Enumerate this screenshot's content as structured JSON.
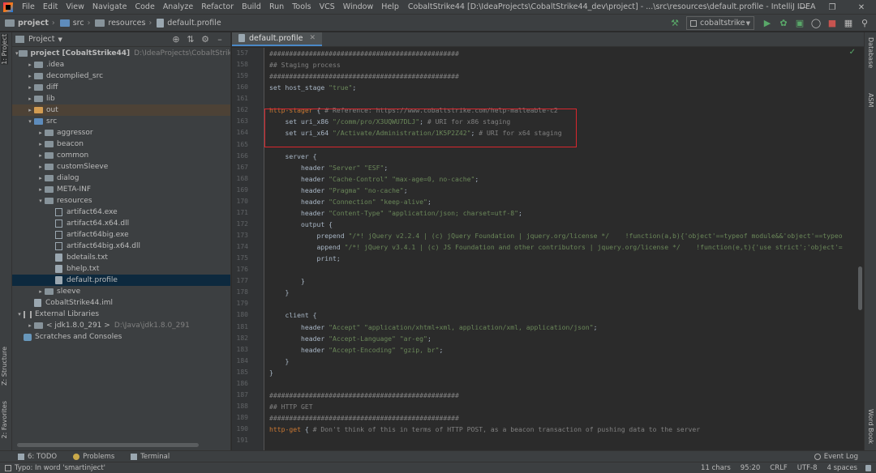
{
  "window": {
    "title": "CobaltStrike44 [D:\\IdeaProjects\\CobaltStrike44_dev\\project] - ...\\src\\resources\\default.profile - IntelliJ IDEA"
  },
  "menu": [
    {
      "label": "File",
      "u": "F",
      "rest": "ile"
    },
    {
      "label": "Edit",
      "u": "E",
      "rest": "dit"
    },
    {
      "label": "View",
      "u": "V",
      "rest": "iew"
    },
    {
      "label": "Navigate",
      "u": "N",
      "rest": "avigate"
    },
    {
      "label": "Code",
      "u": "C",
      "rest": "ode"
    },
    {
      "label": "Analyze",
      "u": "",
      "rest": "Analyze"
    },
    {
      "label": "Refactor",
      "u": "R",
      "rest": "efactor"
    },
    {
      "label": "Build",
      "u": "B",
      "rest": "uild"
    },
    {
      "label": "Run",
      "u": "",
      "rest": "Run"
    },
    {
      "label": "Tools",
      "u": "T",
      "rest": "ools"
    },
    {
      "label": "VCS",
      "u": "",
      "rest": "VCS"
    },
    {
      "label": "Window",
      "u": "W",
      "rest": "indow"
    },
    {
      "label": "Help",
      "u": "H",
      "rest": "elp"
    }
  ],
  "breadcrumbs": [
    "project",
    "src",
    "resources",
    "default.profile"
  ],
  "run_config": "cobaltstrike",
  "left_tools": {
    "project": "1: Project",
    "structure": "Z: Structure",
    "favorites": "2: Favorites"
  },
  "right_tools": {
    "database": "Database",
    "asm": "ASM",
    "word_book": "Word Book"
  },
  "project_panel": {
    "title": "Project"
  },
  "tree": [
    {
      "name": "project [CobaltStrike44]",
      "hint": "D:\\IdeaProjects\\CobaltStrike44_d",
      "depth": 0,
      "arrow": "▾",
      "icon": "folder",
      "bold": true
    },
    {
      "name": ".idea",
      "depth": 1,
      "arrow": "▸",
      "icon": "folder"
    },
    {
      "name": "decomplied_src",
      "depth": 1,
      "arrow": "▸",
      "icon": "folder"
    },
    {
      "name": "diff",
      "depth": 1,
      "arrow": "▸",
      "icon": "folder"
    },
    {
      "name": "lib",
      "depth": 1,
      "arrow": "▸",
      "icon": "folder"
    },
    {
      "name": "out",
      "depth": 1,
      "arrow": "▸",
      "icon": "folder-orange",
      "row": "out"
    },
    {
      "name": "src",
      "depth": 1,
      "arrow": "▾",
      "icon": "folder-blue"
    },
    {
      "name": "aggressor",
      "depth": 2,
      "arrow": "▸",
      "icon": "folder"
    },
    {
      "name": "beacon",
      "depth": 2,
      "arrow": "▸",
      "icon": "folder"
    },
    {
      "name": "common",
      "depth": 2,
      "arrow": "▸",
      "icon": "folder"
    },
    {
      "name": "customSleeve",
      "depth": 2,
      "arrow": "▸",
      "icon": "folder"
    },
    {
      "name": "dialog",
      "depth": 2,
      "arrow": "▸",
      "icon": "folder"
    },
    {
      "name": "META-INF",
      "depth": 2,
      "arrow": "▸",
      "icon": "folder"
    },
    {
      "name": "resources",
      "depth": 2,
      "arrow": "▾",
      "icon": "folder"
    },
    {
      "name": "artifact64.exe",
      "depth": 3,
      "arrow": "",
      "icon": "bin"
    },
    {
      "name": "artifact64.x64.dll",
      "depth": 3,
      "arrow": "",
      "icon": "bin"
    },
    {
      "name": "artifact64big.exe",
      "depth": 3,
      "arrow": "",
      "icon": "bin"
    },
    {
      "name": "artifact64big.x64.dll",
      "depth": 3,
      "arrow": "",
      "icon": "bin"
    },
    {
      "name": "bdetails.txt",
      "depth": 3,
      "arrow": "",
      "icon": "file"
    },
    {
      "name": "bhelp.txt",
      "depth": 3,
      "arrow": "",
      "icon": "file"
    },
    {
      "name": "default.profile",
      "depth": 3,
      "arrow": "",
      "icon": "file",
      "row": "sel"
    },
    {
      "name": "sleeve",
      "depth": 2,
      "arrow": "▸",
      "icon": "folder"
    },
    {
      "name": "CobaltStrike44.iml",
      "depth": 1,
      "arrow": "",
      "icon": "file"
    },
    {
      "name": "External Libraries",
      "depth": 0,
      "arrow": "▾",
      "icon": "lib"
    },
    {
      "name": "< jdk1.8.0_291 >",
      "hint": "D:\\Java\\jdk1.8.0_291",
      "depth": 1,
      "arrow": "▸",
      "icon": "folder"
    },
    {
      "name": "Scratches and Consoles",
      "depth": 0,
      "arrow": "",
      "icon": "scratch"
    }
  ],
  "editor": {
    "tab": "default.profile",
    "lines": [
      {
        "n": "157",
        "t": [
          [
            "cmt",
            "################################################"
          ]
        ]
      },
      {
        "n": "158",
        "t": [
          [
            "cmt",
            "## Staging process"
          ]
        ]
      },
      {
        "n": "159",
        "t": [
          [
            "cmt",
            "################################################"
          ]
        ]
      },
      {
        "n": "160",
        "t": [
          [
            "",
            "set host_stage "
          ],
          [
            "str",
            "\"true\""
          ],
          [
            "",
            ";"
          ]
        ]
      },
      {
        "n": "161",
        "t": []
      },
      {
        "n": "162",
        "t": [
          [
            "kw",
            "http-stager"
          ],
          [
            "",
            " { "
          ],
          [
            "cmt",
            "# Reference: https://www.cobaltstrike.com/help-malleable-c2"
          ]
        ]
      },
      {
        "n": "163",
        "t": [
          [
            "",
            "    set uri_x86 "
          ],
          [
            "str",
            "\"/comm/pro/X3UQWU7DLJ\""
          ],
          [
            "",
            "; "
          ],
          [
            "cmt",
            "# URI for x86 staging"
          ]
        ]
      },
      {
        "n": "164",
        "t": [
          [
            "",
            "    set uri_x64 "
          ],
          [
            "str",
            "\"/Activate/Administration/1K5P2Z42\""
          ],
          [
            "",
            "; "
          ],
          [
            "cmt",
            "# URI for x64 staging"
          ]
        ]
      },
      {
        "n": "165",
        "t": []
      },
      {
        "n": "166",
        "t": [
          [
            "",
            "    server {"
          ]
        ]
      },
      {
        "n": "167",
        "t": [
          [
            "",
            "        header "
          ],
          [
            "str",
            "\"Server\""
          ],
          [
            "",
            " "
          ],
          [
            "str",
            "\"ESF\""
          ],
          [
            "",
            ";"
          ]
        ]
      },
      {
        "n": "168",
        "t": [
          [
            "",
            "        header "
          ],
          [
            "str",
            "\"Cache-Control\""
          ],
          [
            "",
            " "
          ],
          [
            "str",
            "\"max-age=0, no-cache\""
          ],
          [
            "",
            ";"
          ]
        ]
      },
      {
        "n": "169",
        "t": [
          [
            "",
            "        header "
          ],
          [
            "str",
            "\"Pragma\""
          ],
          [
            "",
            " "
          ],
          [
            "str",
            "\"no-cache\""
          ],
          [
            "",
            ";"
          ]
        ]
      },
      {
        "n": "170",
        "t": [
          [
            "",
            "        header "
          ],
          [
            "str",
            "\"Connection\""
          ],
          [
            "",
            " "
          ],
          [
            "str",
            "\"keep-alive\""
          ],
          [
            "",
            ";"
          ]
        ]
      },
      {
        "n": "171",
        "t": [
          [
            "",
            "        header "
          ],
          [
            "str",
            "\"Content-Type\""
          ],
          [
            "",
            " "
          ],
          [
            "str",
            "\"application/json; charset=utf-8\""
          ],
          [
            "",
            ";"
          ]
        ]
      },
      {
        "n": "172",
        "t": [
          [
            "",
            "        output {"
          ]
        ]
      },
      {
        "n": "173",
        "t": [
          [
            "",
            "            prepend "
          ],
          [
            "str",
            "\"/*! jQuery v2.2.4 | (c) jQuery Foundation | jquery.org/license */    !function(a,b){'object'==typeof module&&'object'==typeo"
          ]
        ]
      },
      {
        "n": "174",
        "t": [
          [
            "",
            "            append "
          ],
          [
            "str",
            "\"/*! jQuery v3.4.1 | (c) JS Foundation and other contributors | jquery.org/license */    !function(e,t){'use strict';'object'="
          ]
        ]
      },
      {
        "n": "175",
        "t": [
          [
            "",
            "            print;"
          ]
        ]
      },
      {
        "n": "176",
        "t": []
      },
      {
        "n": "177",
        "t": [
          [
            "",
            "        }"
          ]
        ]
      },
      {
        "n": "178",
        "t": [
          [
            "",
            "    }"
          ]
        ]
      },
      {
        "n": "179",
        "t": []
      },
      {
        "n": "180",
        "t": [
          [
            "",
            "    client {"
          ]
        ]
      },
      {
        "n": "181",
        "t": [
          [
            "",
            "        header "
          ],
          [
            "str",
            "\"Accept\""
          ],
          [
            "",
            " "
          ],
          [
            "str",
            "\"application/xhtml+xml, application/xml, application/json\""
          ],
          [
            "",
            ";"
          ]
        ]
      },
      {
        "n": "182",
        "t": [
          [
            "",
            "        header "
          ],
          [
            "str",
            "\"Accept-Language\""
          ],
          [
            "",
            " "
          ],
          [
            "str",
            "\"ar-eg\""
          ],
          [
            "",
            ";"
          ]
        ]
      },
      {
        "n": "183",
        "t": [
          [
            "",
            "        header "
          ],
          [
            "str",
            "\"Accept-Encoding\""
          ],
          [
            "",
            " "
          ],
          [
            "str",
            "\"gzip, br\""
          ],
          [
            "",
            ";"
          ]
        ]
      },
      {
        "n": "184",
        "t": [
          [
            "",
            "    }"
          ]
        ]
      },
      {
        "n": "185",
        "t": [
          [
            "",
            "}"
          ]
        ]
      },
      {
        "n": "186",
        "t": []
      },
      {
        "n": "187",
        "t": [
          [
            "cmt",
            "################################################"
          ]
        ]
      },
      {
        "n": "188",
        "t": [
          [
            "cmt",
            "## HTTP GET"
          ]
        ]
      },
      {
        "n": "189",
        "t": [
          [
            "cmt",
            "################################################"
          ]
        ]
      },
      {
        "n": "190",
        "t": [
          [
            "kw",
            "http-get"
          ],
          [
            "",
            " { "
          ],
          [
            "cmt",
            "# Don't think of this in terms of HTTP POST, as a beacon transaction of pushing data to the server"
          ]
        ]
      },
      {
        "n": "191",
        "t": []
      }
    ]
  },
  "bottom_tools": [
    {
      "label": "6: TODO"
    },
    {
      "label": "Problems"
    },
    {
      "label": "Terminal"
    }
  ],
  "event_log": "Event Log",
  "status": {
    "message": "Typo: In word 'smartinject'",
    "chars": "11 chars",
    "position": "95:20",
    "line_sep": "CRLF",
    "encoding": "UTF-8",
    "indent": "4 spaces"
  },
  "colors": {
    "keyword": "#cc7832",
    "string": "#6a8759",
    "comment": "#808080",
    "highlight_box": "#d9272e",
    "selection": "#0d293e"
  }
}
